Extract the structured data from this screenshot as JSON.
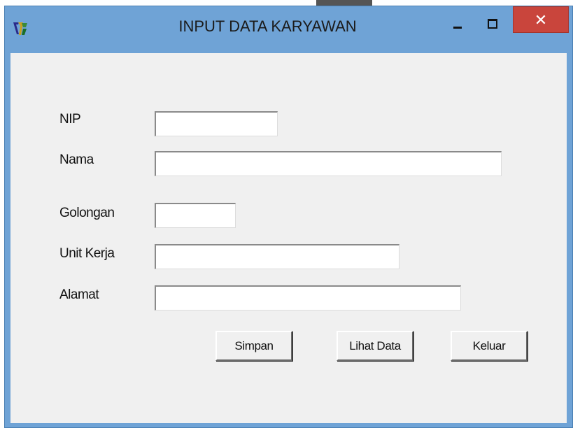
{
  "window": {
    "title": "INPUT DATA KARYAWAN",
    "app_icon": "vb-project-icon",
    "controls": {
      "minimize_icon": "minimize-icon",
      "maximize_icon": "maximize-icon",
      "close_icon": "close-icon",
      "close_glyph": "✕"
    },
    "colors": {
      "titlebar": "#6fa3d6",
      "close_button": "#c9453c",
      "client_area": "#f0f0f0"
    }
  },
  "form": {
    "nip": {
      "label": "NIP",
      "value": ""
    },
    "nama": {
      "label": "Nama",
      "value": ""
    },
    "golongan": {
      "label": "Golongan",
      "value": ""
    },
    "unit_kerja": {
      "label": "Unit Kerja",
      "value": ""
    },
    "alamat": {
      "label": "Alamat",
      "value": ""
    }
  },
  "buttons": {
    "simpan": "Simpan",
    "lihat_data": "Lihat Data",
    "keluar": "Keluar"
  }
}
